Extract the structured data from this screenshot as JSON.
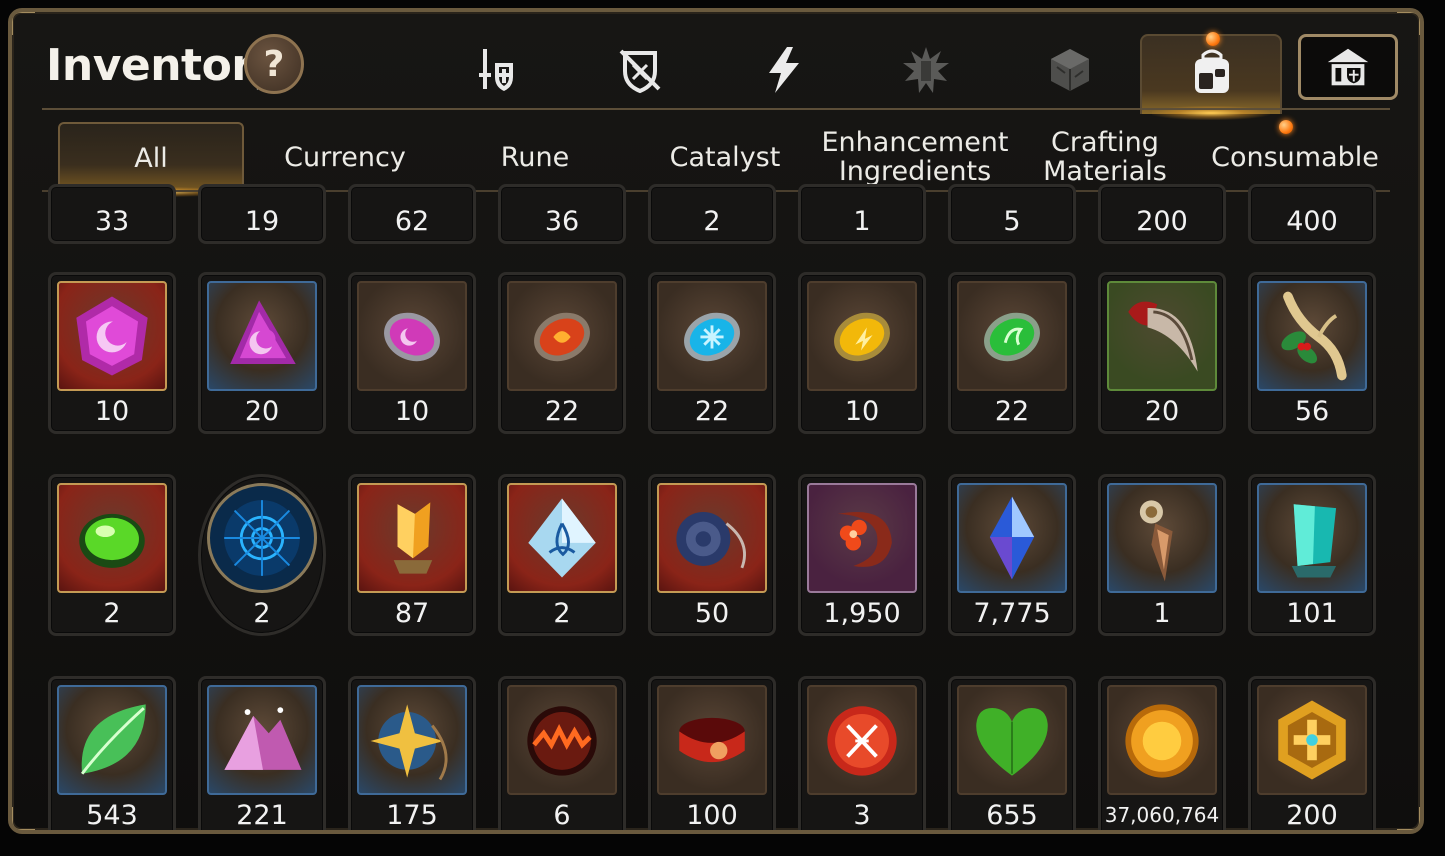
{
  "header": {
    "title": "Inventory",
    "help_label": "?"
  },
  "top_icons": [
    "equipment-icon",
    "no-armor-icon",
    "lightning-icon",
    "burst-icon",
    "cube-icon",
    "bag-icon",
    "shop-icon"
  ],
  "tabs": [
    {
      "label": "All",
      "active": true
    },
    {
      "label": "Currency",
      "active": false
    },
    {
      "label": "Rune",
      "active": false
    },
    {
      "label": "Catalyst",
      "active": false
    },
    {
      "label": "Enhancement Ingredients",
      "line1": "Enhancement",
      "line2": "Ingredients",
      "active": false
    },
    {
      "label": "Crafting Materials",
      "line1": "Crafting",
      "line2": "Materials",
      "active": false
    },
    {
      "label": "Consumable",
      "active": false
    }
  ],
  "rows": [
    {
      "items": [
        {
          "count": "33"
        },
        {
          "count": "19"
        },
        {
          "count": "62"
        },
        {
          "count": "36"
        },
        {
          "count": "2"
        },
        {
          "count": "1"
        },
        {
          "count": "5"
        },
        {
          "count": "200"
        },
        {
          "count": "400"
        }
      ]
    },
    {
      "items": [
        {
          "count": "10",
          "icon": "purple-gem-icon"
        },
        {
          "count": "20",
          "icon": "purple-shard-icon"
        },
        {
          "count": "10",
          "icon": "pink-rune-icon"
        },
        {
          "count": "22",
          "icon": "red-rune-icon"
        },
        {
          "count": "22",
          "icon": "cyan-rune-icon"
        },
        {
          "count": "10",
          "icon": "yellow-rune-icon"
        },
        {
          "count": "22",
          "icon": "green-rune-icon"
        },
        {
          "count": "20",
          "icon": "claw-icon"
        },
        {
          "count": "56",
          "icon": "root-icon"
        }
      ]
    },
    {
      "items": [
        {
          "count": "2",
          "icon": "green-orb-icon"
        },
        {
          "count": "2",
          "icon": "blue-sigil-icon"
        },
        {
          "count": "87",
          "icon": "amber-crystal-icon"
        },
        {
          "count": "2",
          "icon": "triquetra-crystal-icon"
        },
        {
          "count": "50",
          "icon": "amulet-icon"
        },
        {
          "count": "1,950",
          "icon": "flower-crescent-icon"
        },
        {
          "count": "7,775",
          "icon": "blue-diamond-icon"
        },
        {
          "count": "1",
          "icon": "dagger-icon"
        },
        {
          "count": "101",
          "icon": "teal-crystal-icon"
        }
      ]
    },
    {
      "items": [
        {
          "count": "543",
          "icon": "leaf-icon"
        },
        {
          "count": "221",
          "icon": "pink-ore-icon"
        },
        {
          "count": "175",
          "icon": "star-compass-icon"
        },
        {
          "count": "6",
          "icon": "fire-orb-icon"
        },
        {
          "count": "100",
          "icon": "bracelet-icon"
        },
        {
          "count": "3",
          "icon": "red-seal-icon"
        },
        {
          "count": "655",
          "icon": "green-heart-icon"
        },
        {
          "count": "37,060,764",
          "icon": "gold-coin-icon"
        },
        {
          "count": "200",
          "icon": "gold-emblem-icon"
        }
      ]
    }
  ]
}
